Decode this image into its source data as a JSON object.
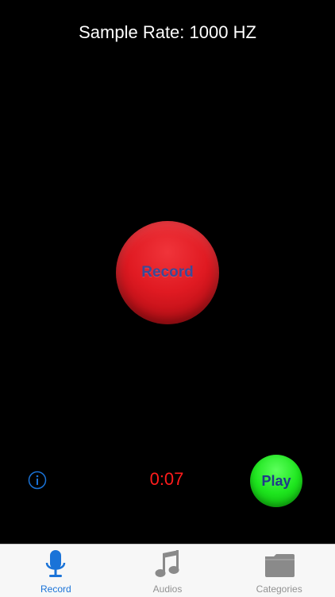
{
  "header": {
    "title": "Sample Rate: 1000 HZ"
  },
  "main": {
    "record_label": "Record",
    "timer": "0:07",
    "play_label": "Play",
    "info_icon": "info-circle-icon"
  },
  "tab_bar": {
    "items": [
      {
        "label": "Record",
        "icon": "microphone-icon",
        "active": true
      },
      {
        "label": "Audios",
        "icon": "music-note-icon",
        "active": false
      },
      {
        "label": "Categories",
        "icon": "folder-icon",
        "active": false
      }
    ]
  },
  "colors": {
    "background": "#000000",
    "record_button": "#e01a22",
    "play_button": "#1ee61e",
    "timer": "#ff1c1c",
    "accent": "#1a73d8",
    "tab_inactive": "#929292"
  }
}
